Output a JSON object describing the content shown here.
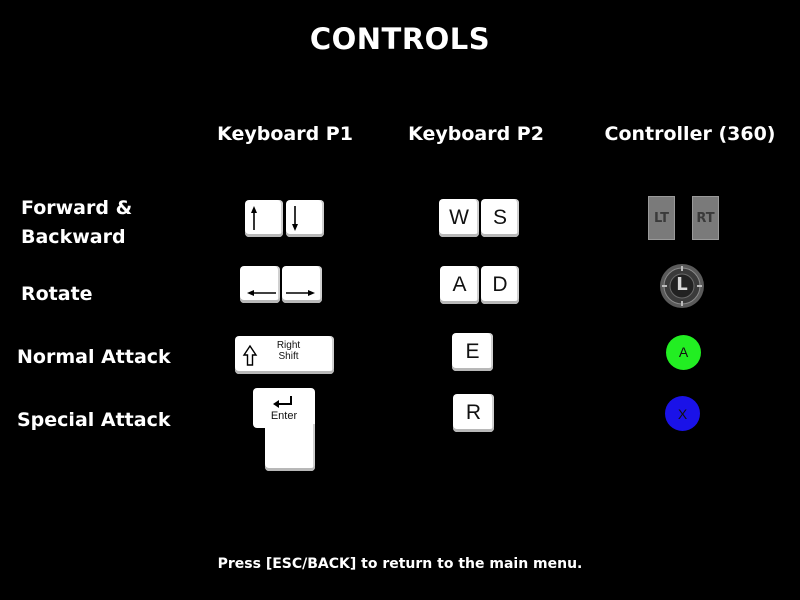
{
  "title": "CONTROLS",
  "columns": [
    "Keyboard P1",
    "Keyboard P2",
    "Controller (360)"
  ],
  "actions": {
    "forward_backward": "Forward &\nBackward",
    "rotate": "Rotate",
    "normal_attack": "Normal Attack",
    "special_attack": "Special Attack"
  },
  "p1": {
    "forward_backward": [
      "up-arrow-icon",
      "down-arrow-icon"
    ],
    "rotate": [
      "left-arrow-icon",
      "right-arrow-icon"
    ],
    "normal_attack": {
      "line1": "Right",
      "line2": "Shift",
      "icon": "shift-arrow-icon"
    },
    "special_attack": {
      "label": "Enter",
      "icon": "enter-arrow-icon"
    }
  },
  "p2": {
    "forward_backward": [
      "W",
      "S"
    ],
    "rotate": [
      "A",
      "D"
    ],
    "normal_attack": "E",
    "special_attack": "R"
  },
  "controller": {
    "forward_backward": [
      "LT",
      "RT"
    ],
    "rotate": "L",
    "normal_attack": "A",
    "special_attack": "X",
    "colors": {
      "a_button": "#22ee22",
      "x_button": "#1a12e8",
      "stick": "#333333"
    }
  },
  "footer": "Press [ESC/BACK] to return to the main menu."
}
